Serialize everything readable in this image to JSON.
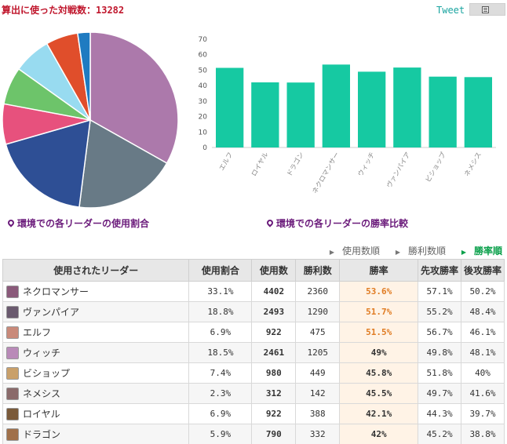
{
  "header": {
    "total_label": "算出に使った対戦数：13282",
    "tweet_label": "Tweet"
  },
  "pie": {
    "caption": "環境での各リーダーの使用割合",
    "slices": [
      {
        "leader": "ネクロマンサー",
        "share": 33.1,
        "color": "#ac79ab"
      },
      {
        "leader": "ヴァンパイア",
        "share": 18.8,
        "color": "#687a86"
      },
      {
        "leader": "ウィッチ",
        "share": 18.5,
        "color": "#2e4f95"
      },
      {
        "leader": "ビショップ",
        "share": 7.4,
        "color": "#e7517d"
      },
      {
        "leader": "エルフ",
        "share": 6.9,
        "color": "#6dc46a"
      },
      {
        "leader": "ロイヤル",
        "share": 6.9,
        "color": "#98dbf0"
      },
      {
        "leader": "ドラゴン",
        "share": 5.9,
        "color": "#e04e2b"
      },
      {
        "leader": "ネメシス",
        "share": 2.3,
        "color": "#1f7bc1"
      }
    ]
  },
  "bar": {
    "caption": "環境での各リーダーの勝率比較"
  },
  "chart_data": {
    "type": "bar",
    "categories": [
      "エルフ",
      "ロイヤル",
      "ドラゴン",
      "ネクロマンサー",
      "ウィッチ",
      "ヴァンパイア",
      "ビショップ",
      "ネメシス"
    ],
    "values": [
      51.5,
      42.1,
      42,
      53.6,
      49,
      51.7,
      45.8,
      45.5
    ],
    "ylim": [
      0,
      70
    ],
    "yticks": [
      0,
      10,
      20,
      30,
      40,
      50,
      60,
      70
    ],
    "grid": false,
    "color": "#16c9a2"
  },
  "sort": {
    "by_usage": "使用数順",
    "by_wins": "勝利数順",
    "by_winrate": "勝率順"
  },
  "table": {
    "headers": {
      "leader": "使用されたリーダー",
      "share": "使用割合",
      "used": "使用数",
      "wins": "勝利数",
      "rate": "勝率",
      "first": "先攻勝率",
      "second": "後攻勝率"
    },
    "rows": [
      {
        "name": "ネクロマンサー",
        "share": "33.1%",
        "used": "4402",
        "wins": "2360",
        "rate": "53.6%",
        "first": "57.1%",
        "second": "50.2%",
        "highlight": true,
        "avatar": "#8a5a7a"
      },
      {
        "name": "ヴァンパイア",
        "share": "18.8%",
        "used": "2493",
        "wins": "1290",
        "rate": "51.7%",
        "first": "55.2%",
        "second": "48.4%",
        "highlight": true,
        "avatar": "#6a5a6e"
      },
      {
        "name": "エルフ",
        "share": "6.9%",
        "used": "922",
        "wins": "475",
        "rate": "51.5%",
        "first": "56.7%",
        "second": "46.1%",
        "highlight": true,
        "avatar": "#c98a7a"
      },
      {
        "name": "ウィッチ",
        "share": "18.5%",
        "used": "2461",
        "wins": "1205",
        "rate": "49%",
        "first": "49.8%",
        "second": "48.1%",
        "highlight": false,
        "avatar": "#b98ab8"
      },
      {
        "name": "ビショップ",
        "share": "7.4%",
        "used": "980",
        "wins": "449",
        "rate": "45.8%",
        "first": "51.8%",
        "second": "40%",
        "highlight": false,
        "avatar": "#c9a06a"
      },
      {
        "name": "ネメシス",
        "share": "2.3%",
        "used": "312",
        "wins": "142",
        "rate": "45.5%",
        "first": "49.7%",
        "second": "41.6%",
        "highlight": false,
        "avatar": "#8a6a6a"
      },
      {
        "name": "ロイヤル",
        "share": "6.9%",
        "used": "922",
        "wins": "388",
        "rate": "42.1%",
        "first": "44.3%",
        "second": "39.7%",
        "highlight": false,
        "avatar": "#7a5a3a"
      },
      {
        "name": "ドラゴン",
        "share": "5.9%",
        "used": "790",
        "wins": "332",
        "rate": "42%",
        "first": "45.2%",
        "second": "38.8%",
        "highlight": false,
        "avatar": "#a0704a"
      }
    ]
  }
}
